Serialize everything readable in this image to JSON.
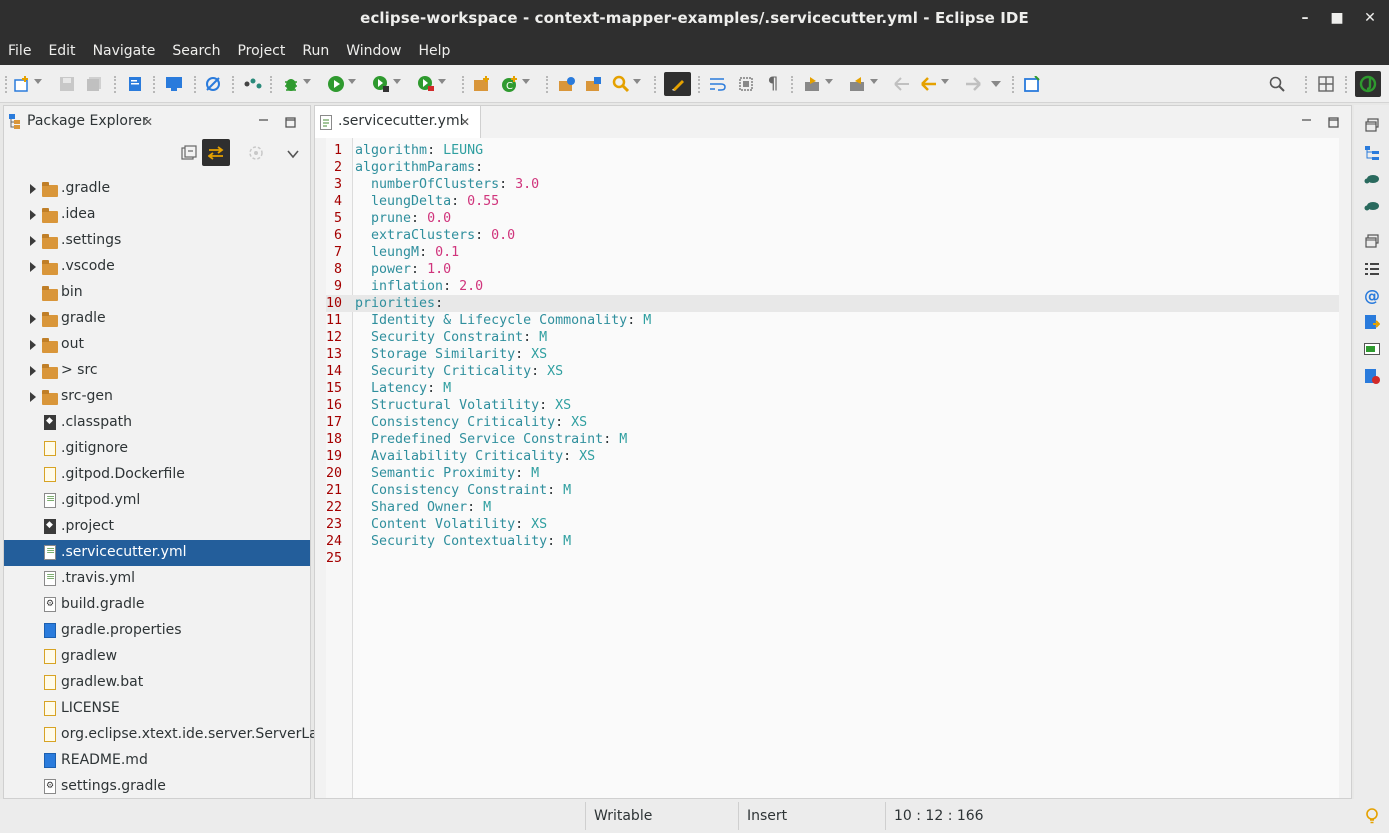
{
  "window": {
    "title": "eclipse-workspace - context-mapper-examples/.servicecutter.yml - Eclipse IDE",
    "minimize": "–",
    "maximize": "■",
    "close": "✕"
  },
  "menu": [
    "File",
    "Edit",
    "Navigate",
    "Search",
    "Project",
    "Run",
    "Window",
    "Help"
  ],
  "package_explorer": {
    "title": "Package Explorer",
    "close_glyph": "✕",
    "items": [
      {
        "label": ".gradle",
        "kind": "folder",
        "expandable": true
      },
      {
        "label": ".idea",
        "kind": "folder",
        "expandable": true
      },
      {
        "label": ".settings",
        "kind": "folder",
        "expandable": true
      },
      {
        "label": ".vscode",
        "kind": "folder",
        "expandable": true
      },
      {
        "label": "bin",
        "kind": "folder",
        "expandable": false
      },
      {
        "label": "gradle",
        "kind": "folder",
        "expandable": true
      },
      {
        "label": "out",
        "kind": "folder",
        "expandable": true
      },
      {
        "label": "> src",
        "kind": "folder",
        "expandable": true
      },
      {
        "label": "src-gen",
        "kind": "folder",
        "expandable": true
      },
      {
        "label": ".classpath",
        "kind": "dark",
        "expandable": false
      },
      {
        "label": ".gitignore",
        "kind": "yellow",
        "expandable": false
      },
      {
        "label": ".gitpod.Dockerfile",
        "kind": "yellow",
        "expandable": false
      },
      {
        "label": ".gitpod.yml",
        "kind": "yml",
        "expandable": false
      },
      {
        "label": ".project",
        "kind": "dark",
        "expandable": false
      },
      {
        "label": ".servicecutter.yml",
        "kind": "yml",
        "expandable": false,
        "selected": true
      },
      {
        "label": ".travis.yml",
        "kind": "yml",
        "expandable": false
      },
      {
        "label": "build.gradle",
        "kind": "gear",
        "expandable": false
      },
      {
        "label": "gradle.properties",
        "kind": "blue",
        "expandable": false
      },
      {
        "label": "gradlew",
        "kind": "yellow",
        "expandable": false
      },
      {
        "label": "gradlew.bat",
        "kind": "yellow",
        "expandable": false
      },
      {
        "label": "LICENSE",
        "kind": "yellow",
        "expandable": false
      },
      {
        "label": "org.eclipse.xtext.ide.server.ServerLaun",
        "kind": "yellow",
        "expandable": false
      },
      {
        "label": "README.md",
        "kind": "blue",
        "expandable": false
      },
      {
        "label": "settings.gradle",
        "kind": "gear",
        "expandable": false
      }
    ]
  },
  "editor": {
    "tab_label": ".servicecutter.yml",
    "tab_close": "✕",
    "current_line": 10,
    "lines": [
      {
        "n": "1",
        "indent": "",
        "key": "algorithm",
        "value": "LEUNG",
        "vtype": "v"
      },
      {
        "n": "2",
        "indent": "",
        "key": "algorithmParams",
        "value": "",
        "vtype": "v"
      },
      {
        "n": "3",
        "indent": "  ",
        "key": "numberOfClusters",
        "value": "3.0",
        "vtype": "n"
      },
      {
        "n": "4",
        "indent": "  ",
        "key": "leungDelta",
        "value": "0.55",
        "vtype": "n"
      },
      {
        "n": "5",
        "indent": "  ",
        "key": "prune",
        "value": "0.0",
        "vtype": "n"
      },
      {
        "n": "6",
        "indent": "  ",
        "key": "extraClusters",
        "value": "0.0",
        "vtype": "n"
      },
      {
        "n": "7",
        "indent": "  ",
        "key": "leungM",
        "value": "0.1",
        "vtype": "n"
      },
      {
        "n": "8",
        "indent": "  ",
        "key": "power",
        "value": "1.0",
        "vtype": "n"
      },
      {
        "n": "9",
        "indent": "  ",
        "key": "inflation",
        "value": "2.0",
        "vtype": "n"
      },
      {
        "n": "10",
        "indent": "",
        "key": "priorities",
        "value": "",
        "vtype": "v"
      },
      {
        "n": "11",
        "indent": "  ",
        "key": "Identity & Lifecycle Commonality",
        "value": "M",
        "vtype": "v"
      },
      {
        "n": "12",
        "indent": "  ",
        "key": "Security Constraint",
        "value": "M",
        "vtype": "v"
      },
      {
        "n": "13",
        "indent": "  ",
        "key": "Storage Similarity",
        "value": "XS",
        "vtype": "v"
      },
      {
        "n": "14",
        "indent": "  ",
        "key": "Security Criticality",
        "value": "XS",
        "vtype": "v"
      },
      {
        "n": "15",
        "indent": "  ",
        "key": "Latency",
        "value": "M",
        "vtype": "v"
      },
      {
        "n": "16",
        "indent": "  ",
        "key": "Structural Volatility",
        "value": "XS",
        "vtype": "v"
      },
      {
        "n": "17",
        "indent": "  ",
        "key": "Consistency Criticality",
        "value": "XS",
        "vtype": "v"
      },
      {
        "n": "18",
        "indent": "  ",
        "key": "Predefined Service Constraint",
        "value": "M",
        "vtype": "v"
      },
      {
        "n": "19",
        "indent": "  ",
        "key": "Availability Criticality",
        "value": "XS",
        "vtype": "v"
      },
      {
        "n": "20",
        "indent": "  ",
        "key": "Semantic Proximity",
        "value": "M",
        "vtype": "v"
      },
      {
        "n": "21",
        "indent": "  ",
        "key": "Consistency Constraint",
        "value": "M",
        "vtype": "v"
      },
      {
        "n": "22",
        "indent": "  ",
        "key": "Shared Owner",
        "value": "M",
        "vtype": "v"
      },
      {
        "n": "23",
        "indent": "  ",
        "key": "Content Volatility",
        "value": "XS",
        "vtype": "v"
      },
      {
        "n": "24",
        "indent": "  ",
        "key": "Security Contextuality",
        "value": "M",
        "vtype": "v"
      },
      {
        "n": "25",
        "indent": "",
        "key": "",
        "value": "",
        "vtype": "v"
      }
    ]
  },
  "status": {
    "writable": "Writable",
    "insert_mode": "Insert",
    "position": "10 : 12 : 166"
  },
  "colors": {
    "selection": "#235e9b",
    "yaml_key": "#2f8f9d",
    "yaml_number": "#d0347c",
    "line_number": "#a40000"
  }
}
